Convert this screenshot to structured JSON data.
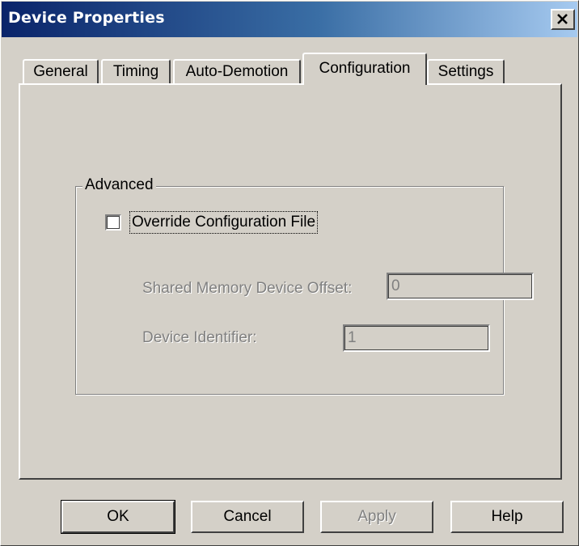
{
  "window": {
    "title": "Device Properties",
    "close_icon": "close-icon"
  },
  "tabs": [
    {
      "label": "General",
      "active": false
    },
    {
      "label": "Timing",
      "active": false
    },
    {
      "label": "Auto-Demotion",
      "active": false
    },
    {
      "label": "Configuration",
      "active": true
    },
    {
      "label": "Settings",
      "active": false
    }
  ],
  "advanced": {
    "group_title": "Advanced",
    "override_label": "Override Configuration File",
    "override_checked": false,
    "shared_memory_label": "Shared Memory Device Offset:",
    "shared_memory_value": "0",
    "device_identifier_label": "Device Identifier:",
    "device_identifier_value": "1"
  },
  "buttons": {
    "ok": "OK",
    "cancel": "Cancel",
    "apply": "Apply",
    "help": "Help"
  },
  "colors": {
    "dialog_face": "#d4d0c8",
    "title_start": "#0a246a",
    "title_end": "#a6caf0",
    "disabled_text": "#808080"
  }
}
